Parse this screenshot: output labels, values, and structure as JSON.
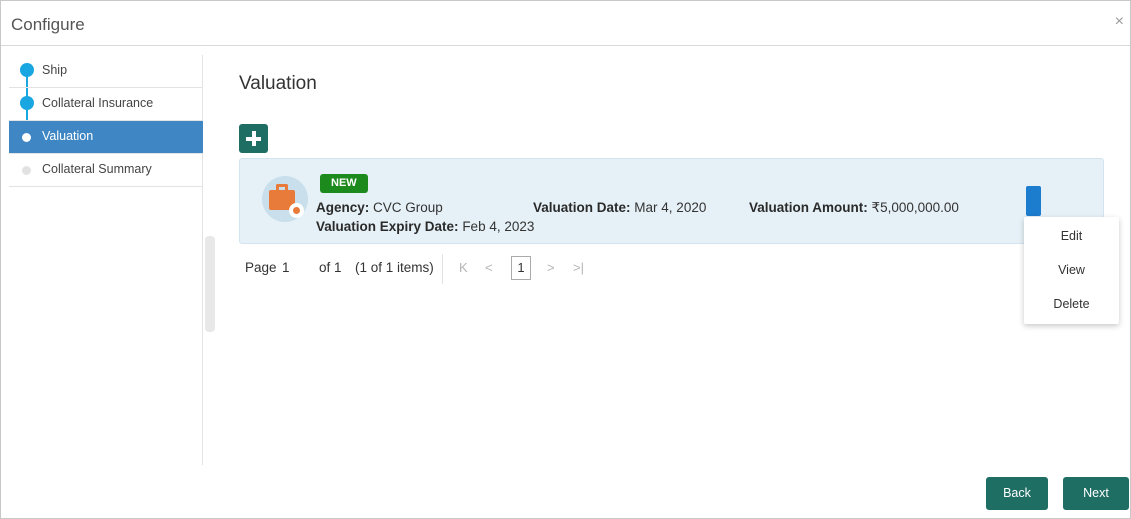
{
  "window": {
    "title": "Configure",
    "close_glyph": "×"
  },
  "sidebar": {
    "steps": [
      {
        "label": "Ship",
        "state": "complete"
      },
      {
        "label": "Collateral Insurance",
        "state": "complete"
      },
      {
        "label": "Valuation",
        "state": "active"
      },
      {
        "label": "Collateral Summary",
        "state": "pending"
      }
    ]
  },
  "main": {
    "title": "Valuation",
    "add_icon": "plus-icon",
    "card": {
      "icon": "briefcase-gear-icon",
      "badge": "NEW",
      "agency_label": "Agency:",
      "agency_value": "CVC Group",
      "date_label": "Valuation Date:",
      "date_value": "Mar 4, 2020",
      "amount_label": "Valuation Amount:",
      "amount_value": "₹5,000,000.00",
      "expiry_label": "Valuation Expiry Date:",
      "expiry_value": "Feb 4, 2023"
    },
    "menu": [
      "Edit",
      "View",
      "Delete"
    ],
    "pager": {
      "page_label": "Page",
      "page_value": "1",
      "of_text": "of 1",
      "items_text": "(1 of 1 items)",
      "current": "1",
      "first_glyph": "K",
      "prev_glyph": "<",
      "next_glyph": ">",
      "last_glyph": ">|"
    }
  },
  "footer": {
    "back_label": "Back",
    "next_label": "Next"
  },
  "colors": {
    "accent": "#1f6e64",
    "active_step": "#3f86c4",
    "step_dot": "#1aa6e0",
    "badge": "#1d8a1d",
    "card_bg": "#e6f1f7"
  }
}
